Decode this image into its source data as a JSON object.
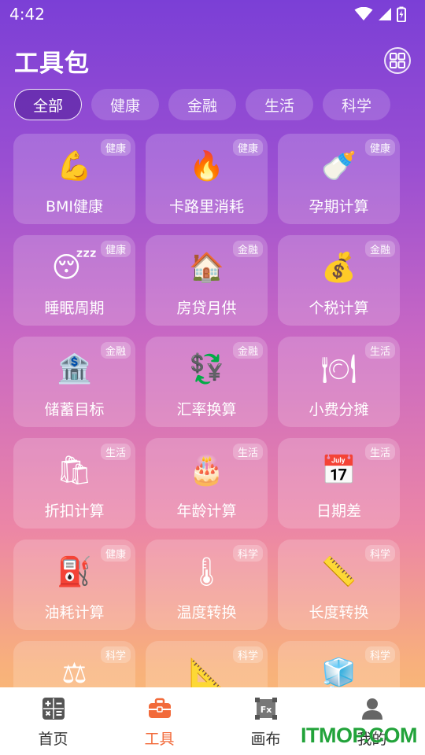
{
  "status_bar": {
    "time": "4:42"
  },
  "header": {
    "title": "工具包",
    "grid_icon": "grid-view-icon"
  },
  "tabs": [
    {
      "label": "全部",
      "active": true
    },
    {
      "label": "健康",
      "active": false
    },
    {
      "label": "金融",
      "active": false
    },
    {
      "label": "生活",
      "active": false
    },
    {
      "label": "科学",
      "active": false
    }
  ],
  "tools": [
    {
      "label": "BMI健康",
      "badge": "健康",
      "icon": "💪",
      "icon_name": "flexed-biceps-icon"
    },
    {
      "label": "卡路里消耗",
      "badge": "健康",
      "icon": "🔥",
      "icon_name": "fire-icon"
    },
    {
      "label": "孕期计算",
      "badge": "健康",
      "icon": "🍼",
      "icon_name": "baby-bottle-icon"
    },
    {
      "label": "睡眠周期",
      "badge": "健康",
      "icon": "😴",
      "icon_name": "sleeping-face-icon"
    },
    {
      "label": "房贷月供",
      "badge": "金融",
      "icon": "🏠",
      "icon_name": "house-icon"
    },
    {
      "label": "个税计算",
      "badge": "金融",
      "icon": "💰",
      "icon_name": "money-bag-icon"
    },
    {
      "label": "储蓄目标",
      "badge": "金融",
      "icon": "🏦",
      "icon_name": "bank-icon"
    },
    {
      "label": "汇率换算",
      "badge": "金融",
      "icon": "💱",
      "icon_name": "currency-exchange-icon"
    },
    {
      "label": "小费分摊",
      "badge": "生活",
      "icon": "🍽",
      "icon_name": "plate-cutlery-icon"
    },
    {
      "label": "折扣计算",
      "badge": "生活",
      "icon": "🛍",
      "icon_name": "shopping-bags-icon"
    },
    {
      "label": "年龄计算",
      "badge": "生活",
      "icon": "🎂",
      "icon_name": "birthday-cake-icon"
    },
    {
      "label": "日期差",
      "badge": "生活",
      "icon": "📅",
      "icon_name": "calendar-icon"
    },
    {
      "label": "油耗计算",
      "badge": "健康",
      "icon": "⛽",
      "icon_name": "fuel-pump-icon"
    },
    {
      "label": "温度转换",
      "badge": "科学",
      "icon": "🌡",
      "icon_name": "thermometer-icon"
    },
    {
      "label": "长度转换",
      "badge": "科学",
      "icon": "📏",
      "icon_name": "ruler-icon"
    },
    {
      "label": "",
      "badge": "科学",
      "icon": "⚖",
      "icon_name": "balance-scale-icon"
    },
    {
      "label": "",
      "badge": "科学",
      "icon": "📐",
      "icon_name": "triangle-ruler-icon"
    },
    {
      "label": "",
      "badge": "科学",
      "icon": "🧊",
      "icon_name": "cube-icon"
    }
  ],
  "bottom_nav": [
    {
      "label": "首页",
      "icon_name": "calculator-icon",
      "active": false
    },
    {
      "label": "工具",
      "icon_name": "toolbox-icon",
      "active": true
    },
    {
      "label": "画布",
      "icon_name": "function-canvas-icon",
      "active": false
    },
    {
      "label": "我的",
      "icon_name": "user-icon",
      "active": false
    }
  ],
  "watermark": "ITMOP.COM",
  "colors": {
    "accent": "#f26a3a",
    "watermark": "#22a33a"
  }
}
